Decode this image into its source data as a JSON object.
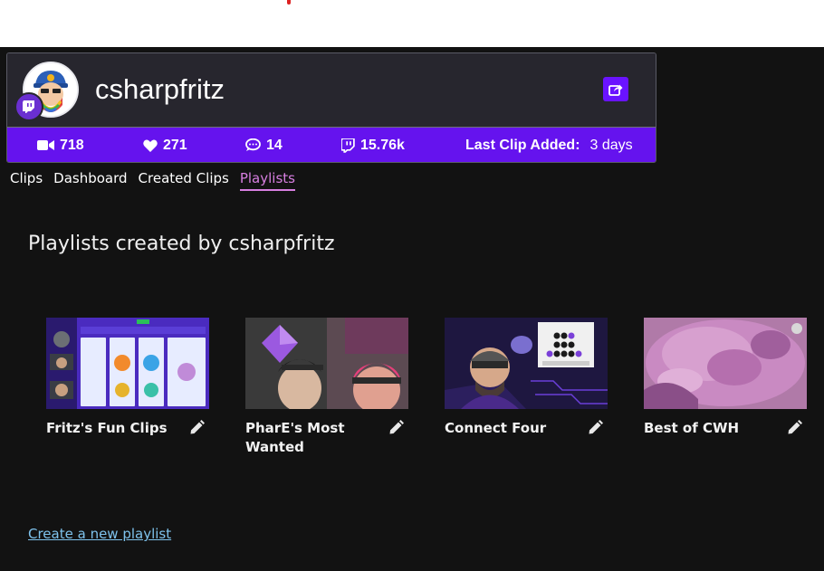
{
  "profile": {
    "username": "csharpfritz",
    "share_icon": "share-icon",
    "platform_icon": "twitch-icon"
  },
  "stats": {
    "clips": {
      "icon": "video-camera-icon",
      "value": "718"
    },
    "likes": {
      "icon": "heart-icon",
      "value": "271"
    },
    "comments": {
      "icon": "comment-icon",
      "value": "14"
    },
    "views": {
      "icon": "twitch-icon",
      "value": "15.76k"
    },
    "last_clip": {
      "label": "Last Clip Added:",
      "value": "3 days"
    }
  },
  "nav": {
    "tabs": [
      {
        "label": "Clips",
        "active": false
      },
      {
        "label": "Dashboard",
        "active": false
      },
      {
        "label": "Created Clips",
        "active": false
      },
      {
        "label": "Playlists",
        "active": true
      }
    ]
  },
  "main": {
    "title": "Playlists created by csharpfritz",
    "playlists": [
      {
        "title": "Fritz's Fun Clips",
        "edit_icon": "pencil-icon"
      },
      {
        "title": "PharE's Most Wanted",
        "edit_icon": "pencil-icon"
      },
      {
        "title": "Connect Four",
        "edit_icon": "pencil-icon"
      },
      {
        "title": "Best of CWH",
        "edit_icon": "pencil-icon"
      }
    ],
    "create_link": "Create a new playlist"
  },
  "colors": {
    "accent": "#6513ee",
    "active_tab": "#d77fe0",
    "link": "#7ec2ec",
    "background": "#121212"
  }
}
